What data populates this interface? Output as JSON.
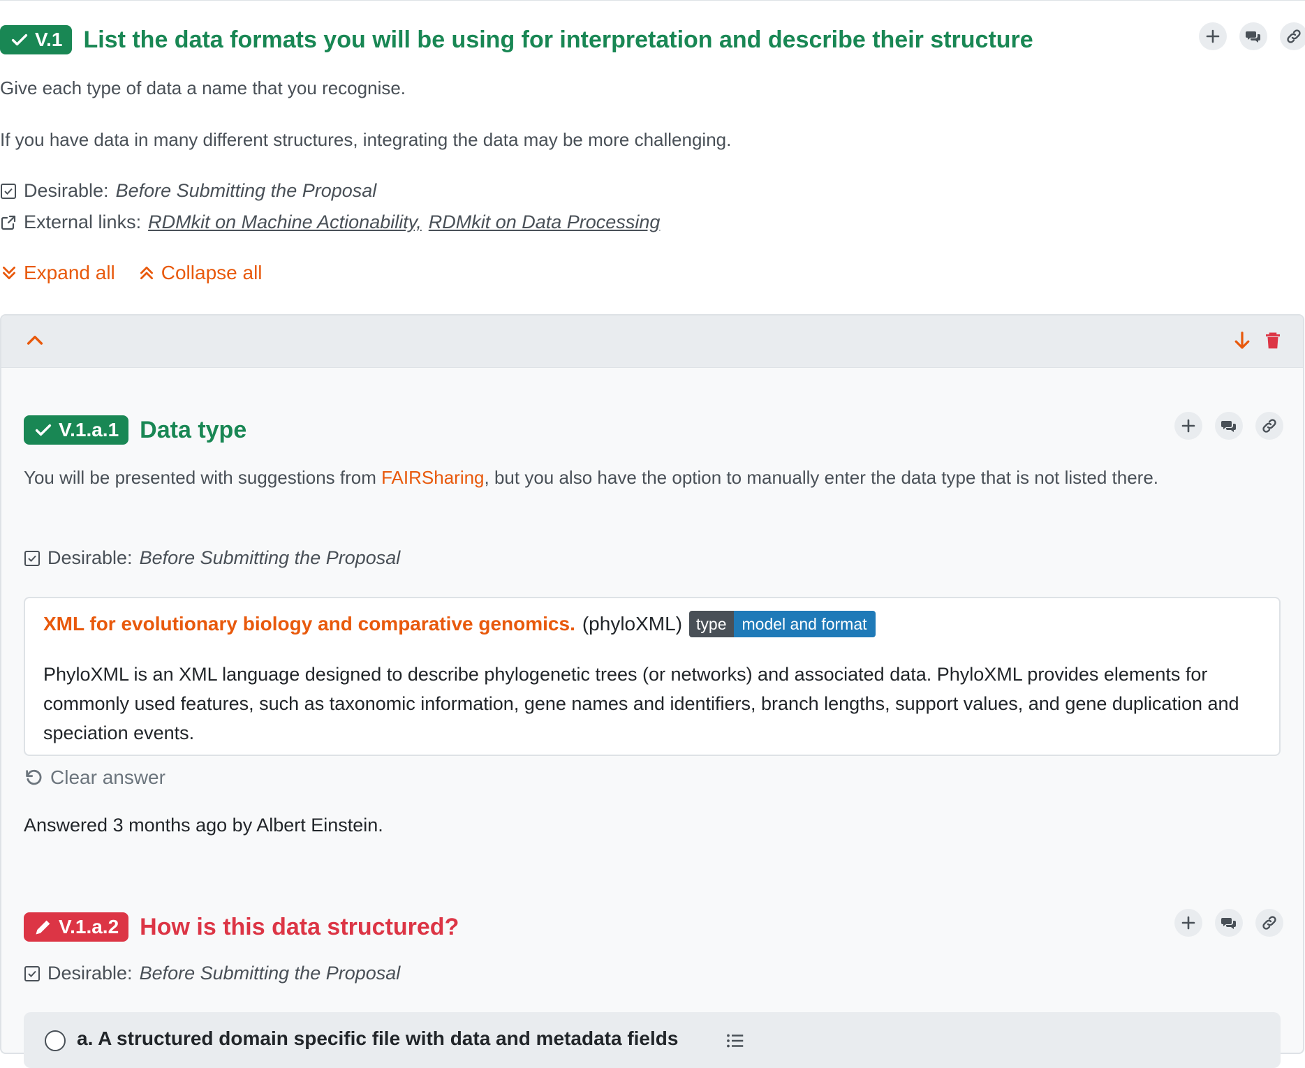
{
  "question": {
    "badge": "V.1",
    "title": "List the data formats you will be using for interpretation and describe their structure",
    "para1": "Give each type of data a name that you recognise.",
    "para2": "If you have data in many different structures, integrating the data may be more challenging.",
    "desirable_label": "Desirable:",
    "desirable_value": "Before Submitting the Proposal",
    "external_label": "External links:",
    "links": [
      "RDMkit on Machine Actionability,",
      "RDMkit on Data Processing"
    ]
  },
  "controls": {
    "expand_all": "Expand all",
    "collapse_all": "Collapse all"
  },
  "sub1": {
    "badge": "V.1.a.1",
    "title": "Data type",
    "desc_before": "You will be presented with suggestions from ",
    "desc_link": "FAIRSharing",
    "desc_after": ", but you also have the option to manually enter the data type that is not listed there.",
    "desirable_label": "Desirable:",
    "desirable_value": "Before Submitting the Proposal",
    "answer": {
      "title": "XML for evolutionary biology and comparative genomics.",
      "abbr": "(phyloXML)",
      "tag_key": "type",
      "tag_value": "model and format",
      "description": "PhyloXML is an XML language designed to describe phylogenetic trees (or networks) and associated data. PhyloXML provides elements for commonly used features, such as taxonomic information, gene names and identifiers, branch lengths, support values, and gene duplication and speciation events."
    },
    "clear_answer": "Clear answer",
    "answered": "Answered 3 months ago by Albert Einstein."
  },
  "sub2": {
    "badge": "V.1.a.2",
    "title": "How is this data structured?",
    "desirable_label": "Desirable:",
    "desirable_value": "Before Submitting the Proposal",
    "option_a": "a. A structured domain specific file with data and metadata fields"
  },
  "colors": {
    "green": "#198754",
    "red": "#dc3545",
    "orange": "#e8590c"
  }
}
